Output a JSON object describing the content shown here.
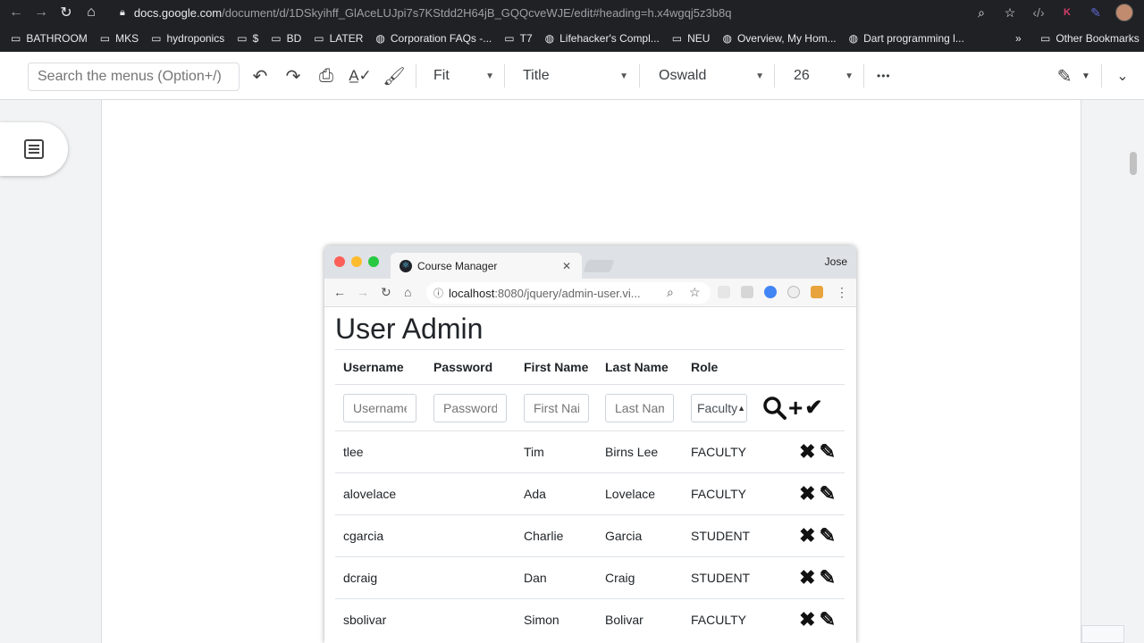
{
  "browser": {
    "url_host": "docs.google.com",
    "url_path": "/document/d/1DSkyihff_GlAceLUJpi7s7KStdd2H64jB_GQQcveWJE/edit#heading=h.x4wgqj5z3b8q"
  },
  "bookmarks": {
    "items": [
      {
        "label": "BATHROOM",
        "icon": "folder-icon"
      },
      {
        "label": "MKS",
        "icon": "folder-icon"
      },
      {
        "label": "hydroponics",
        "icon": "folder-icon"
      },
      {
        "label": "$",
        "icon": "folder-icon"
      },
      {
        "label": "BD",
        "icon": "folder-icon"
      },
      {
        "label": "LATER",
        "icon": "folder-icon"
      },
      {
        "label": "Corporation FAQs -...",
        "icon": "globe-icon"
      },
      {
        "label": "T7",
        "icon": "folder-icon"
      },
      {
        "label": "Lifehacker's Compl...",
        "icon": "globe-icon"
      },
      {
        "label": "NEU",
        "icon": "folder-icon"
      },
      {
        "label": "Overview, My Hom...",
        "icon": "globe-icon"
      },
      {
        "label": "Dart programming l...",
        "icon": "globe-icon"
      }
    ],
    "more": "»",
    "other": "Other Bookmarks"
  },
  "docs_toolbar": {
    "search_placeholder": "Search the menus (Option+/)",
    "zoom": "Fit",
    "style": "Title",
    "font": "Oswald",
    "size": "26",
    "more": "•••"
  },
  "embedded": {
    "tab_title": "Course Manager",
    "user": "Jose",
    "address_host": "localhost",
    "address_rest": ":8080/jquery/admin-user.vi...",
    "page_title": "User Admin",
    "columns": [
      "Username",
      "Password",
      "First Name",
      "Last Name",
      "Role"
    ],
    "input_placeholders": {
      "username": "Username",
      "password": "Password",
      "first": "First Nai",
      "last": "Last Nam",
      "role": "Faculty"
    },
    "rows": [
      {
        "username": "tlee",
        "password": "",
        "first": "Tim",
        "last": "Birns Lee",
        "role": "FACULTY"
      },
      {
        "username": "alovelace",
        "password": "",
        "first": "Ada",
        "last": "Lovelace",
        "role": "FACULTY"
      },
      {
        "username": "cgarcia",
        "password": "",
        "first": "Charlie",
        "last": "Garcia",
        "role": "STUDENT"
      },
      {
        "username": "dcraig",
        "password": "",
        "first": "Dan",
        "last": "Craig",
        "role": "STUDENT"
      },
      {
        "username": "sbolivar",
        "password": "",
        "first": "Simon",
        "last": "Bolivar",
        "role": "FACULTY"
      }
    ]
  }
}
